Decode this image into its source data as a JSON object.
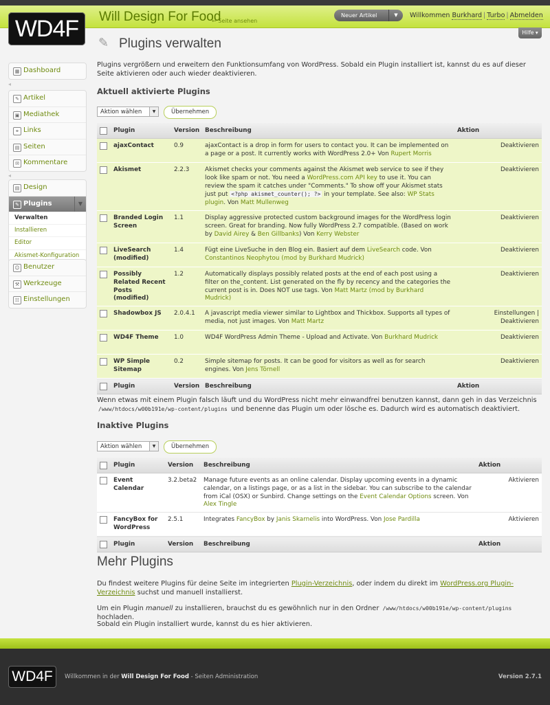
{
  "header": {
    "logo": "WD4F",
    "site_title": "Will Design For Food",
    "view_site": "← Seite ansehen",
    "new_article": "Neuer Artikel",
    "welcome_prefix": "Willkommen",
    "user": "Burkhard",
    "turbo": "Turbo",
    "logout": "Abmelden",
    "help": "Hilfe"
  },
  "sidebar": {
    "dashboard": "Dashboard",
    "group1": [
      "Artikel",
      "Mediathek",
      "Links",
      "Seiten",
      "Kommentare"
    ],
    "design": "Design",
    "plugins": "Plugins",
    "plugins_sub": [
      "Verwalten",
      "Installieren",
      "Editor",
      "Akismet-Konfiguration"
    ],
    "group3": [
      "Benutzer",
      "Werkzeuge",
      "Einstellungen"
    ]
  },
  "page": {
    "title": "Plugins verwalten",
    "intro": "Plugins vergrößern und erweitern den Funktionsumfang von WordPress. Sobald ein Plugin installiert ist, kannst du es auf dieser Seite aktivieren oder auch wieder deaktivieren.",
    "active_heading": "Aktuell aktivierte Plugins",
    "inactive_heading": "Inaktive Plugins",
    "bulk_label": "Aktion wählen",
    "apply_label": "Übernehmen",
    "col_plugin": "Plugin",
    "col_version": "Version",
    "col_desc": "Beschreibung",
    "col_action": "Aktion",
    "warning_pre": "Wenn etwas mit einem Plugin falsch läuft und du WordPress nicht mehr einwandfrei benutzen kannst, dann geh in das Verzeichnis",
    "warning_path": "/www/htdocs/w00b191e/wp-content/plugins",
    "warning_post": "und benenne das Plugin um oder lösche es. Dadurch wird es automatisch deaktiviert.",
    "more_heading": "Mehr Plugins",
    "more_p1_a": "Du findest weitere Plugins für deine Seite im integrierten",
    "more_p1_link1": "Plugin-Verzeichnis",
    "more_p1_b": ", oder indem du direkt im",
    "more_p1_link2": "WordPress.org Plugin-Verzeichnis",
    "more_p1_c": "suchst und manuell installierst.",
    "more_p2_a": "Um ein Plugin",
    "more_p2_em": "manuell",
    "more_p2_b": "zu installieren, brauchst du es gewöhnlich nur in den Ordner",
    "more_p2_path": "/www/htdocs/w00b191e/wp-content/plugins",
    "more_p2_c": "hochladen.",
    "more_p3": "Sobald ein Plugin installiert wurde, kannst du es hier aktivieren."
  },
  "active_plugins": [
    {
      "name": "ajaxContact",
      "version": "0.9",
      "desc": "ajaxContact is a drop in form for users to contact you. It can be implemented on a page or a post. It currently works with WordPress 2.0+ Von ",
      "author": "Rupert Morris",
      "action": "Deaktivieren"
    },
    {
      "name": "Akismet",
      "version": "2.2.3",
      "desc": "Akismet checks your comments against the Akismet web service to see if they look like spam or not. You need a ",
      "link": "WordPress.com API key",
      "desc2": " to use it. You can review the spam it catches under \"Comments.\" To show off your Akismet stats just put ",
      "code": "<?php akismet_counter(); ?>",
      "desc3": " in your template. See also: ",
      "link2": "WP Stats plugin",
      "desc4": ". Von ",
      "author": "Matt Mullenweg",
      "action": "Deaktivieren"
    },
    {
      "name": "Branded Login Screen",
      "version": "1.1",
      "desc": "Display aggressive protected custom background images for the WordPress login screen. Great for branding. Now fully WordPress 2.7 compatible. (Based on work by ",
      "author": "David Airey",
      "amp": " & ",
      "author2": "Ben Gillbanks",
      "desc2": ") Von ",
      "author3": "Kerry Webster",
      "action": "Deaktivieren"
    },
    {
      "name": "LiveSearch (modified)",
      "version": "1.4",
      "desc": "Fügt eine LiveSuche in den Blog ein. Basiert auf dem ",
      "link": "LiveSearch",
      "desc2": " code. Von ",
      "author": "Constantinos Neophytou (mod by Burkhard Mudrick)",
      "action": "Deaktivieren"
    },
    {
      "name": "Possibly Related Recent Posts (modified)",
      "version": "1.2",
      "desc": "Automatically displays possibly related posts at the end of each post using a filter on the_content. List generated on the fly by recency and the categories the current post is in. Does NOT use tags. Von ",
      "author": "Matt Martz (mod by Burkhard Mudrick)",
      "action": "Deaktivieren"
    },
    {
      "name": "Shadowbox JS",
      "version": "2.0.4.1",
      "desc": "A javascript media viewer similar to Lightbox and Thickbox. Supports all types of media, not just images. Von ",
      "author": "Matt Martz",
      "action": "Einstellungen | Deaktivieren"
    },
    {
      "name": "WD4F Theme",
      "version": "1.0",
      "desc": "WD4F WordPress Admin Theme - Upload and Activate. Von ",
      "author": "Burkhard Mudrick",
      "action": "Deaktivieren"
    },
    {
      "name": "WP Simple Sitemap",
      "version": "0.2",
      "desc": "Simple sitemap for posts. It can be good for visitors as well as for search engines. Von ",
      "author": "Jens Törnell",
      "action": "Deaktivieren"
    }
  ],
  "inactive_plugins": [
    {
      "name": "Event Calendar",
      "version": "3.2.beta2",
      "desc": "Manage future events as an online calendar. Display upcoming events in a dynamic calendar, on a listings page, or as a list in the sidebar. You can subscribe to the calendar from iCal (OSX) or Sunbird. Change settings on the ",
      "link": "Event Calendar Options",
      "desc2": " screen. Von ",
      "author": "Alex Tingle",
      "action": "Aktivieren"
    },
    {
      "name": "FancyBox for WordPress",
      "version": "2.5.1",
      "desc": "Integrates ",
      "link": "FancyBox",
      "desc2": " by ",
      "author2": "Janis Skarnelis",
      "desc3": " into WordPress. Von ",
      "author": "Jose Pardilla",
      "action": "Aktivieren"
    }
  ],
  "footer": {
    "logo": "WD4F",
    "text_pre": "Willkommen in der",
    "site": "Will Design For Food",
    "text_post": "- Seiten Administration",
    "version": "Version 2.7.1"
  }
}
